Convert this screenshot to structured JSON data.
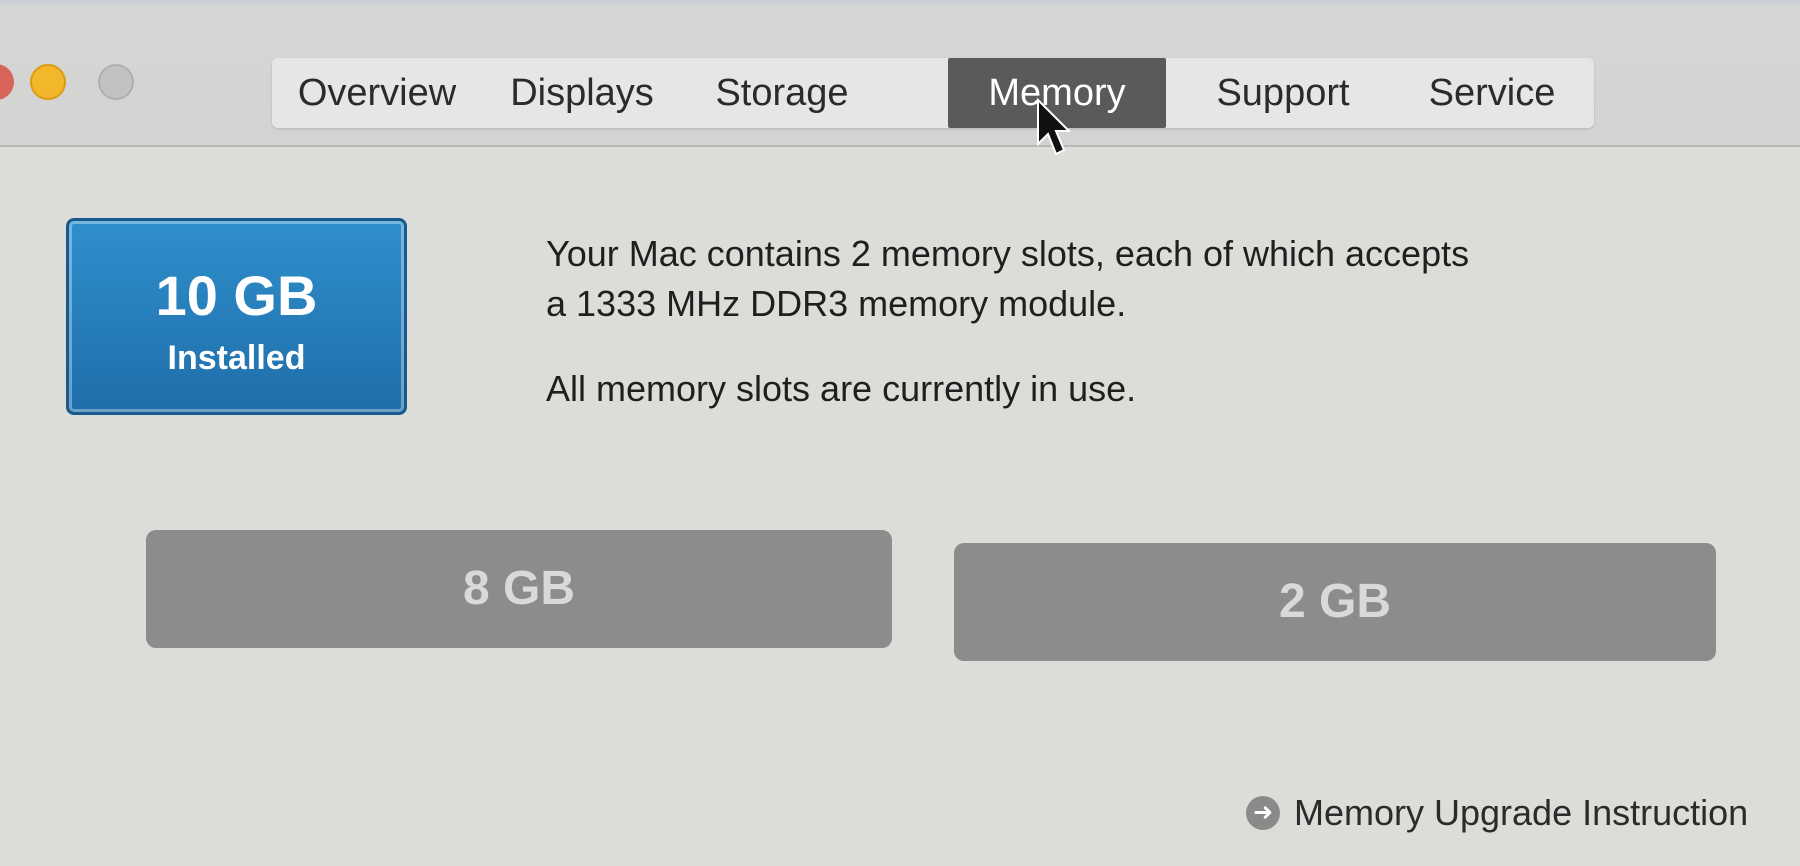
{
  "tabs": [
    {
      "label": "Overview"
    },
    {
      "label": "Displays"
    },
    {
      "label": "Storage"
    },
    {
      "label": "Memory"
    },
    {
      "label": "Support"
    },
    {
      "label": "Service"
    }
  ],
  "active_tab": "Memory",
  "installed": {
    "amount": "10 GB",
    "label": "Installed"
  },
  "description": {
    "line1": "Your Mac contains 2 memory slots, each of which accepts",
    "line2": "a 1333 MHz DDR3 memory module.",
    "line3": "All memory slots are currently in use."
  },
  "slots": [
    {
      "size": "8 GB"
    },
    {
      "size": "2 GB"
    }
  ],
  "upgrade_link": {
    "label": "Memory Upgrade Instruction"
  },
  "colors": {
    "installed_box": "#2080c0",
    "slot_fill": "#8c8c8c",
    "active_tab": "#5a5a5a",
    "traffic_yellow": "#f2b72a"
  }
}
